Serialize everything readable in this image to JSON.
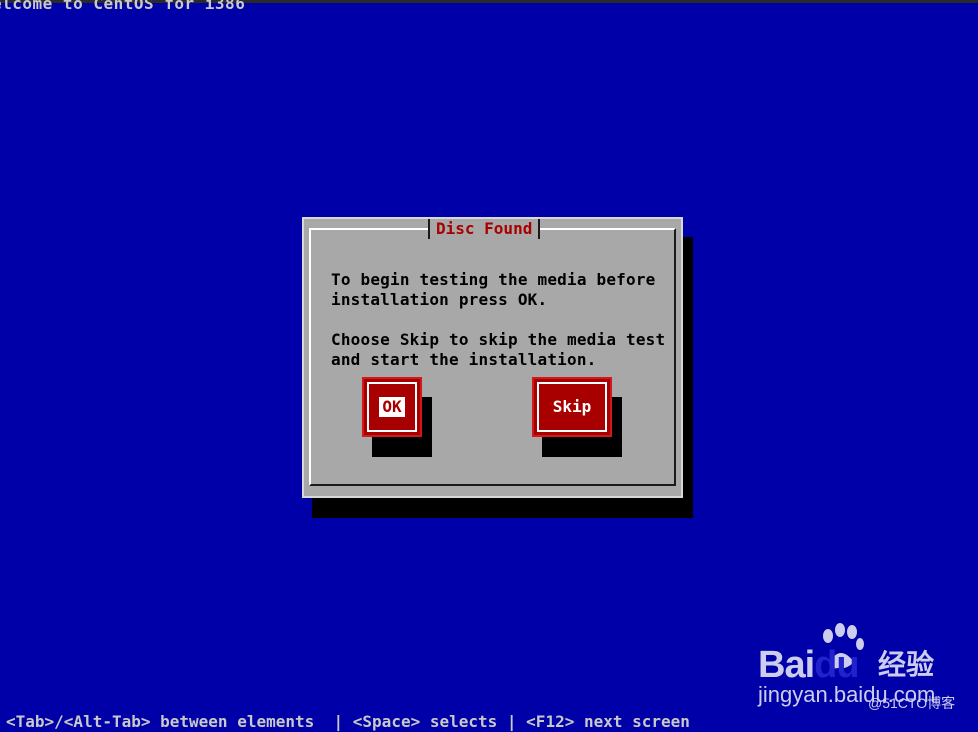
{
  "screen": {
    "header_text": "elcome to CentOS for i386",
    "footer_text": "<Tab>/<Alt-Tab> between elements  | <Space> selects | <F12> next screen"
  },
  "dialog": {
    "title": "Disc Found",
    "message_1": "To begin testing the media before\ninstallation press OK.",
    "message_2": "Choose Skip to skip the media test\nand start the installation.",
    "ok_label": "OK",
    "skip_label": "Skip",
    "focused_button": "OK"
  },
  "watermark": {
    "logo_left": "Bai",
    "logo_right": "du",
    "logo_cn": "经验",
    "url": "jingyan.baidu.com",
    "blog": "@51CTO博客"
  },
  "colors": {
    "background": "#0000a8",
    "dialog": "#a8a8a8",
    "title": "#a80000",
    "button": "#a80000"
  }
}
